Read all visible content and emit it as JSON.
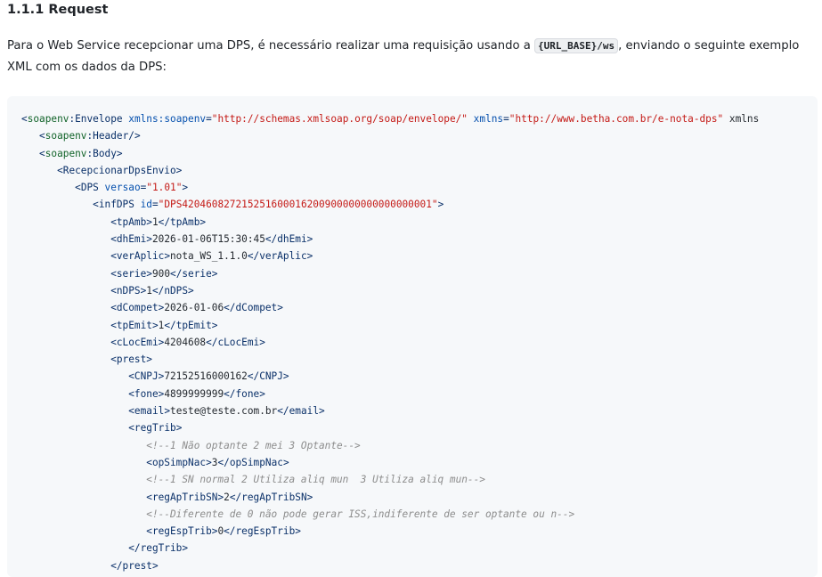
{
  "section": {
    "title": "1.1.1 Request",
    "intro_before": "Para o Web Service recepcionar uma DPS, é necessário realizar uma requisição usando a ",
    "intro_code": "{URL_BASE}/ws",
    "intro_after": ", enviando o seguinte exemplo XML com os dados da DPS:"
  },
  "code_lines": [
    "<soapenv:Envelope xmlns:soapenv=\"http://schemas.xmlsoap.org/soap/envelope/\" xmlns=\"http://www.betha.com.br/e-nota-dps\" xmlns",
    "   <soapenv:Header/>",
    "   <soapenv:Body>",
    "      <RecepcionarDpsEnvio>",
    "         <DPS versao=\"1.01\">",
    "            <infDPS id=\"DPS420460827215251600016200900000000000000001\">",
    "               <tpAmb>1</tpAmb>",
    "               <dhEmi>2026-01-06T15:30:45</dhEmi>",
    "               <verAplic>nota_WS_1.1.0</verAplic>",
    "               <serie>900</serie>",
    "               <nDPS>1</nDPS>",
    "               <dCompet>2026-01-06</dCompet>",
    "               <tpEmit>1</tpEmit>",
    "               <cLocEmi>4204608</cLocEmi>",
    "               <prest>",
    "                  <CNPJ>72152516000162</CNPJ>",
    "                  <fone>4899999999</fone>",
    "                  <email>teste@teste.com.br</email>",
    "                  <regTrib>",
    "                     <!--1 Não optante 2 mei 3 Optante-->",
    "                     <opSimpNac>3</opSimpNac>",
    "                     <!--1 SN normal 2 Utiliza aliq mun  3 Utiliza aliq mun-->",
    "                     <regApTribSN>2</regApTribSN>",
    "                     <!--Diferente de 0 não pode gerar ISS,indiferente de ser optante ou n-->",
    "                     <regEspTrib>0</regEspTrib>",
    "                  </regTrib>",
    "               </prest>"
  ]
}
